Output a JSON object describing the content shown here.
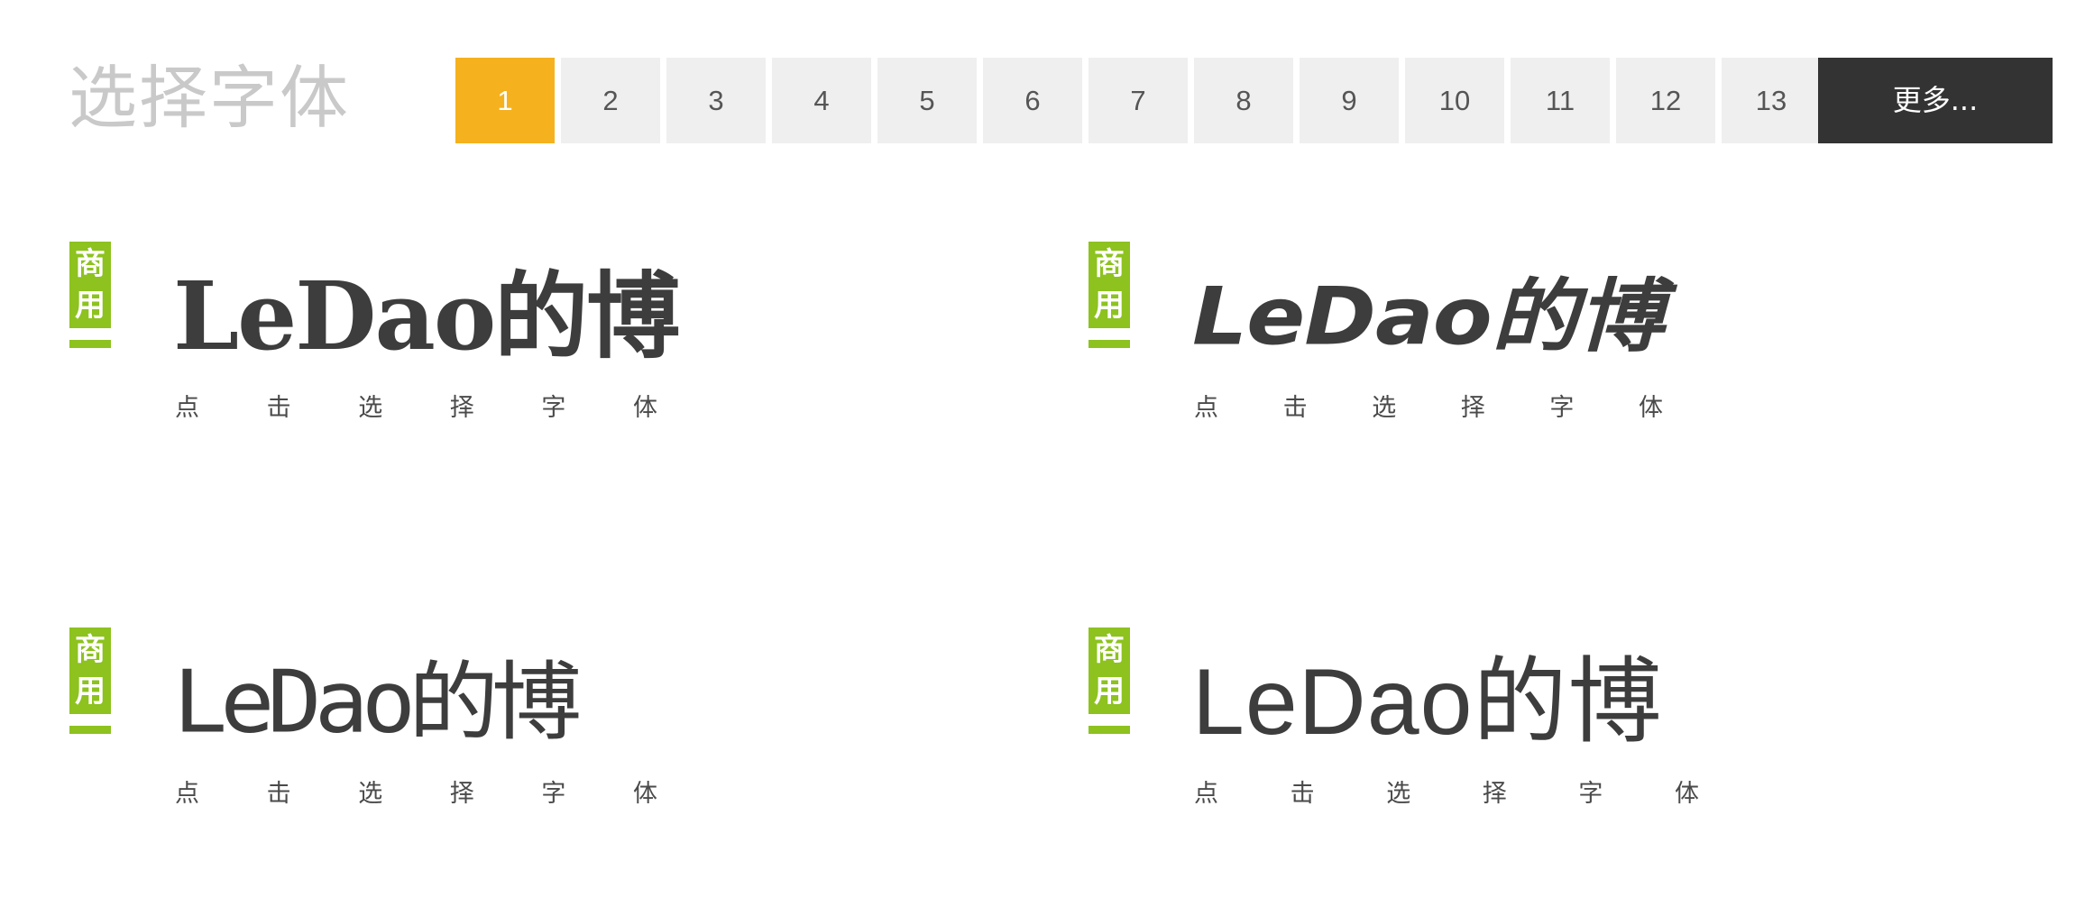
{
  "header": {
    "title": "选择字体"
  },
  "pagination": {
    "pages": [
      "1",
      "2",
      "3",
      "4",
      "5",
      "6",
      "7",
      "8",
      "9",
      "10",
      "11",
      "12",
      "13"
    ],
    "active_page": "1",
    "more_label": "更多...",
    "active_color": "#f5b21e",
    "more_color": "#333333"
  },
  "fonts": [
    {
      "badge_top": "商",
      "badge_bottom": "用",
      "preview": "LeDao的博",
      "hint": [
        "点",
        "击",
        "选",
        "择",
        "字",
        "体"
      ]
    },
    {
      "badge_top": "商",
      "badge_bottom": "用",
      "preview": "LeDao的博",
      "hint": [
        "点",
        "击",
        "选",
        "择",
        "字",
        "体"
      ]
    },
    {
      "badge_top": "商",
      "badge_bottom": "用",
      "preview": "LeDao的博",
      "hint": [
        "点",
        "击",
        "选",
        "择",
        "字",
        "体"
      ]
    },
    {
      "badge_top": "商",
      "badge_bottom": "用",
      "preview": "LeDao的博",
      "hint": [
        "点",
        "击",
        "选",
        "择",
        "字",
        "体"
      ]
    }
  ],
  "badge_color": "#8dc21f"
}
